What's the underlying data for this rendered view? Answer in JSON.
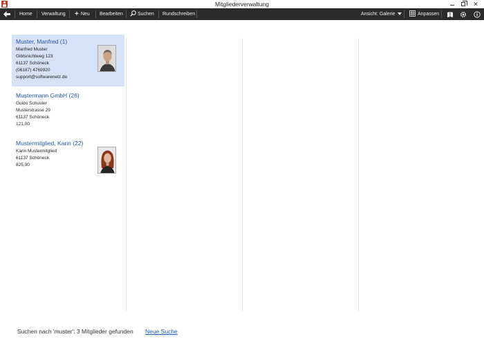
{
  "window": {
    "title": "Mitgliederverwaltung",
    "app_icon": "member-app-icon"
  },
  "toolbar": {
    "back_icon": "back-arrow-icon",
    "home": "Home",
    "verwaltung": "Verwaltung",
    "neu": "Neu",
    "bearbeiten": "Bearbeiten",
    "suchen": "Suchen",
    "rundschreiben": "Rundschreiben",
    "ansicht": "Ansicht: Galerie",
    "anpassen": "Anpassen",
    "background_color": "#2b2b2b"
  },
  "gallery": {
    "selected_color": "#d5e2f7",
    "title_color": "#2855a8",
    "cards": [
      {
        "title": "Muster, Manfred  (1)",
        "lines": [
          "Manfred Muster",
          "Gibtsnichtweg 123",
          "61137 Schöneck",
          "(06187) 4769920",
          "support@softwarenetz.de"
        ],
        "selected": true,
        "photo": "male-portrait-photo"
      },
      {
        "title": "Mustermann GmbH  (26)",
        "lines": [
          "Guido Schuster",
          "Musterstrasse 29",
          "61137 Schöneck",
          "121,00"
        ],
        "selected": false
      },
      {
        "title": "Mustermitglied, Karin  (22)",
        "lines": [
          "Karin Mustermitglied",
          "61137 Schöneck",
          "825,00"
        ],
        "selected": false,
        "photo": "female-portrait-photo"
      }
    ]
  },
  "status": {
    "text": "Suchen nach 'muster':  3 Mitglieder gefunden",
    "link": "Neue Suche"
  }
}
